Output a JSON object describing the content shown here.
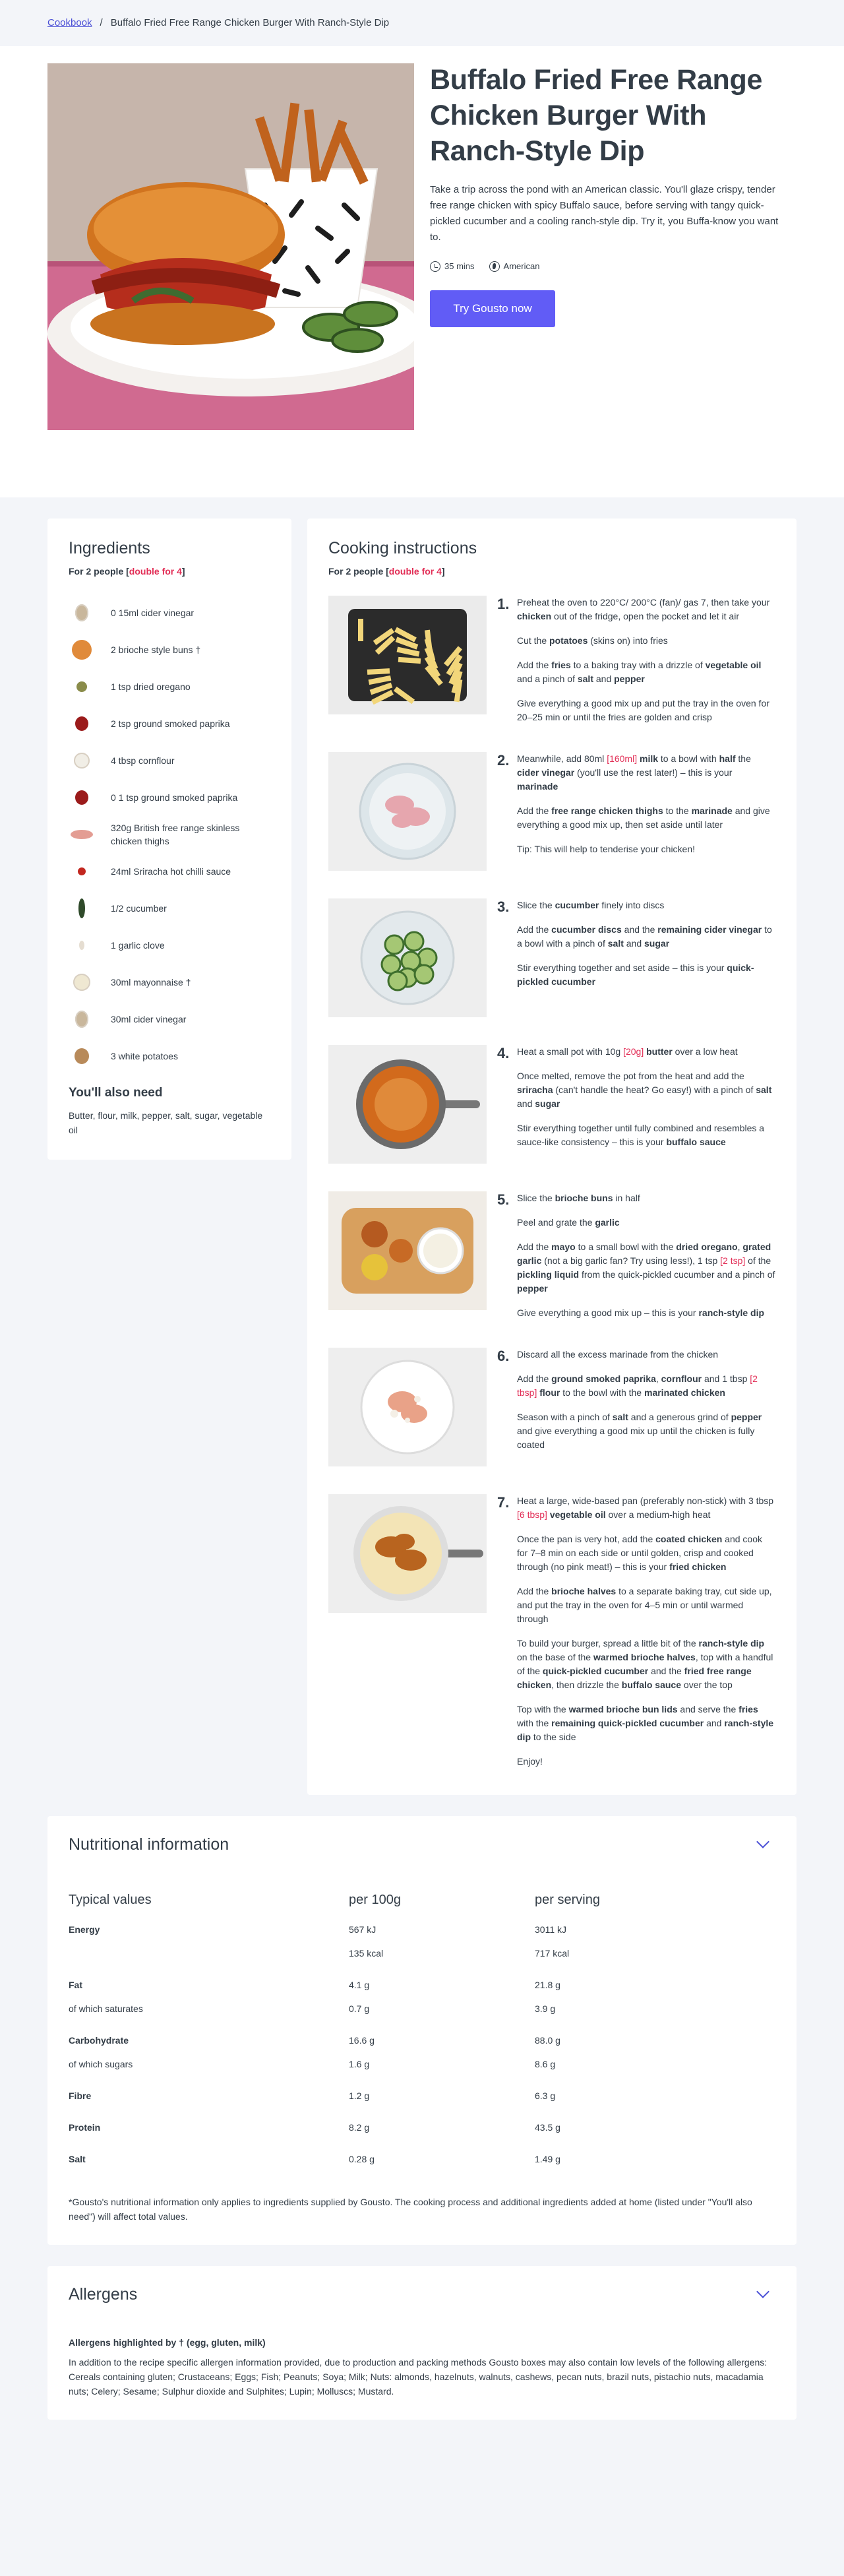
{
  "breadcrumb": {
    "root": "Cookbook",
    "separator": "/",
    "current": "Buffalo Fried Free Range Chicken Burger With Ranch-Style Dip"
  },
  "hero": {
    "title": "Buffalo Fried Free Range Chicken Burger With Ranch-Style Dip",
    "description": "Take a trip across the pond with an American classic. You'll glaze crispy, tender free range chicken with spicy Buffalo sauce, before serving with tangy quick-pickled cucumber and a cooling ranch-style dip. Try it, you Buffa-know you want to.",
    "time": "35 mins",
    "cuisine": "American",
    "cta": "Try Gousto now"
  },
  "ingredients": {
    "title": "Ingredients",
    "portion_prefix": "For 2 people [",
    "portion_link": "double for 4",
    "portion_suffix": "]",
    "items": [
      {
        "text": "0 15ml cider vinegar",
        "color": "#c9b79c",
        "icon": "vinegar"
      },
      {
        "text": "2 brioche style buns †",
        "color": "#e08a3a",
        "icon": "bun"
      },
      {
        "text": "1 tsp dried oregano",
        "color": "#8a8c4a",
        "icon": "oregano"
      },
      {
        "text": "2 tsp ground smoked paprika",
        "color": "#9b1b1b",
        "icon": "paprika"
      },
      {
        "text": "4 tbsp cornflour",
        "color": "#f1eee6",
        "icon": "cornflour"
      },
      {
        "text": "0 1 tsp ground smoked paprika",
        "color": "#9b1b1b",
        "icon": "paprika"
      },
      {
        "text": "320g British free range skinless chicken thighs",
        "color": "#e39d93",
        "icon": "chicken"
      },
      {
        "text": "24ml Sriracha hot chilli sauce",
        "color": "#c2271f",
        "icon": "sriracha"
      },
      {
        "text": "1/2 cucumber",
        "color": "#2f4a2a",
        "icon": "cucumber"
      },
      {
        "text": "1 garlic clove",
        "color": "#e5ddd1",
        "icon": "garlic"
      },
      {
        "text": "30ml mayonnaise †",
        "color": "#efe8d2",
        "icon": "mayonnaise"
      },
      {
        "text": "30ml cider vinegar",
        "color": "#c9b79c",
        "icon": "vinegar"
      },
      {
        "text": "3 white potatoes",
        "color": "#b88a5a",
        "icon": "potato"
      }
    ],
    "also_title": "You'll also need",
    "also_text": "Butter, flour, milk, pepper, salt, sugar, vegetable oil"
  },
  "cooking": {
    "title": "Cooking instructions",
    "portion_prefix": "For 2 people [",
    "portion_link": "double for 4",
    "portion_suffix": "]",
    "steps": [
      {
        "num": "1.",
        "paragraphs": [
          "Preheat the oven to 220°C/ 200°C (fan)/ gas 7, then take your <b>chicken</b> out of the fridge, open the pocket and let it air",
          "Cut the <b>potatoes</b> (skins on) into fries",
          "Add the <b>fries</b> to a baking tray with a drizzle of <b>vegetable oil</b> and a pinch of <b>salt</b> and <b>pepper</b>",
          "Give everything a good mix up and put the tray in the oven for 20–25 min or until the fries are golden and crisp"
        ]
      },
      {
        "num": "2.",
        "paragraphs": [
          "Meanwhile, add 80ml <span class=\"red\">[160ml]</span> <b>milk</b> to a bowl with <b>half</b> the <b>cider vinegar</b> (you'll use the rest later!) – this is your <b>marinade</b>",
          "Add the <b>free range chicken thighs</b> to the <b>marinade</b> and give everything a good mix up, then set aside until later",
          "Tip: This will help to tenderise your chicken!"
        ]
      },
      {
        "num": "3.",
        "paragraphs": [
          "Slice the <b>cucumber</b> finely into discs",
          "Add the <b>cucumber discs</b> and the <b>remaining cider vinegar</b> to a bowl with a pinch of <b>salt</b> and <b>sugar</b>",
          "Stir everything together and set aside – this is your <b>quick-pickled cucumber</b>"
        ]
      },
      {
        "num": "4.",
        "paragraphs": [
          "Heat a small pot with 10g <span class=\"red\">[20g]</span> <b>butter</b> over a low heat",
          "Once melted, remove the pot from the heat and add the <b>sriracha</b> (can't handle the heat? Go easy!) with a pinch of <b>salt</b> and <b>sugar</b>",
          "Stir everything together until fully combined and resembles a sauce-like consistency – this is your <b>buffalo sauce</b>"
        ]
      },
      {
        "num": "5.",
        "paragraphs": [
          "Slice the <b>brioche buns</b> in half",
          "Peel and grate the <b>garlic</b>",
          "Add the <b>mayo</b> to a small bowl with the <b>dried oregano</b>, <b>grated garlic</b> (not a big garlic fan? Try using less!), 1 tsp <span class=\"red\">[2 tsp]</span> of the <b>pickling liquid</b> from the quick-pickled cucumber and a pinch of <b>pepper</b>",
          "Give everything a good mix up – this is your <b>ranch-style dip</b>"
        ]
      },
      {
        "num": "6.",
        "paragraphs": [
          "Discard all the excess marinade from the chicken",
          "Add the <b>ground smoked paprika</b>, <b>cornflour</b> and 1 tbsp <span class=\"red\">[2 tbsp]</span> <b>flour</b> to the bowl with the <b>marinated chicken</b>",
          "Season with a pinch of <b>salt</b> and a generous grind of <b>pepper</b> and give everything a good mix up until the chicken is fully coated"
        ]
      },
      {
        "num": "7.",
        "paragraphs": [
          "Heat a large, wide-based pan (preferably non-stick) with 3 tbsp <span class=\"red\">[6 tbsp]</span> <b>vegetable oil</b> over a medium-high heat",
          "Once the pan is very hot, add the <b>coated chicken</b> and cook for 7–8 min on each side or until golden, crisp and cooked through (no pink meat!) – this is your <b>fried chicken</b>",
          "Add the <b>brioche halves</b> to a separate baking tray, cut side up, and put the tray in the oven for 4–5 min or until warmed through",
          "To build your burger, spread a little bit of the <b>ranch-style dip</b> on the base of the <b>warmed brioche halves</b>, top with a handful of the <b>quick-pickled cucumber</b> and the <b>fried free range chicken</b>, then drizzle the <b>buffalo sauce</b> over the top",
          "Top with the <b>warmed brioche bun lids</b> and serve the <b>fries</b> with the <b>remaining quick-pickled cucumber</b> and <b>ranch-style dip</b> to the side",
          "Enjoy!"
        ]
      }
    ]
  },
  "nutrition": {
    "title": "Nutritional information",
    "headers": [
      "Typical values",
      "per 100g",
      "per serving"
    ],
    "rows": [
      {
        "label": "Energy",
        "strong": true,
        "per100": "567 kJ",
        "serving": "3011 kJ"
      },
      {
        "label": "",
        "strong": false,
        "per100": "135 kcal",
        "serving": "717 kcal"
      },
      {
        "label": "Fat",
        "strong": true,
        "per100": "4.1 g",
        "serving": "21.8 g"
      },
      {
        "label": "of which saturates",
        "strong": false,
        "per100": "0.7 g",
        "serving": "3.9 g"
      },
      {
        "label": "Carbohydrate",
        "strong": true,
        "per100": "16.6 g",
        "serving": "88.0 g"
      },
      {
        "label": "of which sugars",
        "strong": false,
        "per100": "1.6 g",
        "serving": "8.6 g"
      },
      {
        "label": "Fibre",
        "strong": true,
        "per100": "1.2 g",
        "serving": "6.3 g"
      },
      {
        "label": "Protein",
        "strong": true,
        "per100": "8.2 g",
        "serving": "43.5 g"
      },
      {
        "label": "Salt",
        "strong": true,
        "per100": "0.28 g",
        "serving": "1.49 g"
      }
    ],
    "footnote": "*Gousto's nutritional information only applies to ingredients supplied by Gousto. The cooking process and additional ingredients added at home (listed under \"You'll also need\") will affect total values."
  },
  "allergens": {
    "title": "Allergens",
    "highlighted": "Allergens highlighted by † (egg, gluten, milk)",
    "text": "In addition to the recipe specific allergen information provided, due to production and packing methods Gousto boxes may also contain low levels of the following allergens: Cereals containing gluten; Crustaceans; Eggs; Fish; Peanuts; Soya; Milk; Nuts: almonds, hazelnuts, walnuts, cashews, pecan nuts, brazil nuts, pistachio nuts, macadamia nuts; Celery; Sesame; Sulphur dioxide and Sulphites; Lupin; Molluscs; Mustard."
  },
  "colors": {
    "accent": "#615cf6",
    "link": "#4a4fd6",
    "highlight": "#e22e56",
    "page_bg": "#f3f5f9"
  }
}
